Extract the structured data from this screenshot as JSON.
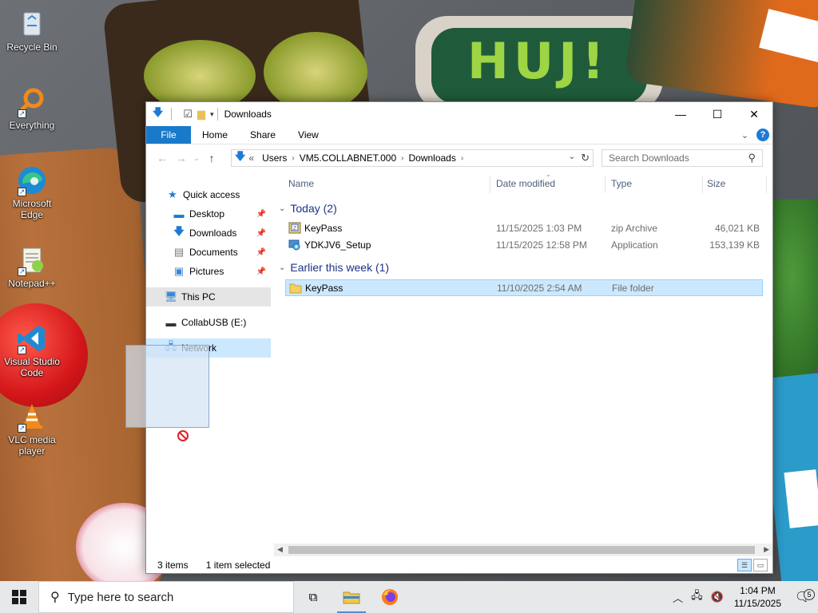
{
  "desktop": {
    "icons": [
      {
        "label": "Recycle Bin",
        "icon": "recycle-bin-icon"
      },
      {
        "label": "Everything",
        "icon": "everything-search-icon"
      },
      {
        "label": "Microsoft Edge",
        "icon": "edge-icon"
      },
      {
        "label": "Notepad++",
        "icon": "notepad-plus-plus-icon"
      },
      {
        "label": "Visual Studio Code",
        "icon": "vscode-icon"
      },
      {
        "label": "VLC media player",
        "icon": "vlc-icon"
      }
    ],
    "wallpaper_text": "HUJ!"
  },
  "window": {
    "title": "Downloads",
    "ribbon_tabs": [
      "File",
      "Home",
      "Share",
      "View"
    ],
    "address": {
      "prefix": "«",
      "crumbs": [
        "Users",
        "VM5.COLLABNET.000",
        "Downloads"
      ]
    },
    "search_placeholder": "Search Downloads",
    "sidebar": [
      {
        "label": "Quick access",
        "icon": "star-icon",
        "pinned": false
      },
      {
        "label": "Desktop",
        "icon": "desktop-icon",
        "pinned": true
      },
      {
        "label": "Downloads",
        "icon": "download-arrow-icon",
        "pinned": true
      },
      {
        "label": "Documents",
        "icon": "documents-icon",
        "pinned": true
      },
      {
        "label": "Pictures",
        "icon": "pictures-icon",
        "pinned": true
      },
      {
        "label": "This PC",
        "icon": "computer-icon",
        "pinned": false
      },
      {
        "label": "CollabUSB (E:)",
        "icon": "usb-drive-icon",
        "pinned": false
      },
      {
        "label": "Network",
        "icon": "network-icon",
        "pinned": false
      }
    ],
    "columns": [
      "Name",
      "Date modified",
      "Type",
      "Size"
    ],
    "groups": [
      {
        "label": "Today (2)",
        "files": [
          {
            "name": "KeyPass",
            "date": "11/15/2025 1:03 PM",
            "type": "zip Archive",
            "size": "46,021 KB",
            "icon": "zip-archive-icon"
          },
          {
            "name": "YDKJV6_Setup",
            "date": "11/15/2025 12:58 PM",
            "type": "Application",
            "size": "153,139 KB",
            "icon": "setup-application-icon"
          }
        ]
      },
      {
        "label": "Earlier this week (1)",
        "files": [
          {
            "name": "KeyPass",
            "date": "11/10/2025 2:54 AM",
            "type": "File folder",
            "size": "",
            "icon": "folder-icon",
            "selected": true
          }
        ]
      }
    ],
    "status": {
      "items": "3 items",
      "selected": "1 item selected"
    }
  },
  "taskbar": {
    "search_placeholder": "Type here to search",
    "time": "1:04 PM",
    "date": "11/15/2025",
    "notification_count": "5"
  }
}
